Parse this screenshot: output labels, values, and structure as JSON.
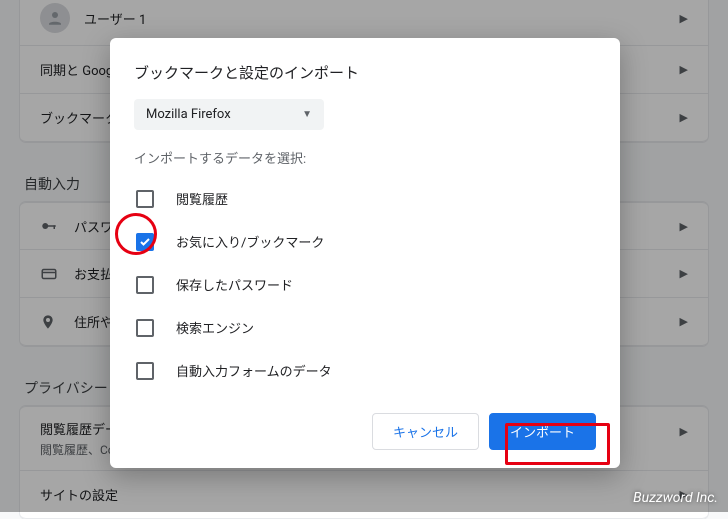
{
  "bg": {
    "rows_top": [
      {
        "label": "ユーザー 1"
      },
      {
        "label": "同期と Google サービス"
      },
      {
        "label": "ブックマークと設定のインポート"
      }
    ],
    "section_autofill": "自動入力",
    "rows_autofill": [
      {
        "icon": "key-icon",
        "label": "パスワード"
      },
      {
        "icon": "card-icon",
        "label": "お支払い方法"
      },
      {
        "icon": "pin-icon",
        "label": "住所やその他の情報"
      }
    ],
    "section_privacy": "プライバシーとセキュリティ",
    "rows_privacy": [
      {
        "label": "閲覧履歴データの削除",
        "sub": "閲覧履歴、Cookie、キャッシュなどを削除します"
      },
      {
        "label": "サイトの設定"
      }
    ]
  },
  "dialog": {
    "title": "ブックマークと設定のインポート",
    "select_value": "Mozilla Firefox",
    "hint": "インポートするデータを選択:",
    "items": [
      {
        "label": "閲覧履歴",
        "checked": false
      },
      {
        "label": "お気に入り/ブックマーク",
        "checked": true
      },
      {
        "label": "保存したパスワード",
        "checked": false
      },
      {
        "label": "検索エンジン",
        "checked": false
      },
      {
        "label": "自動入力フォームのデータ",
        "checked": false
      }
    ],
    "cancel": "キャンセル",
    "submit": "インポート"
  },
  "watermark": "Buzzword Inc."
}
